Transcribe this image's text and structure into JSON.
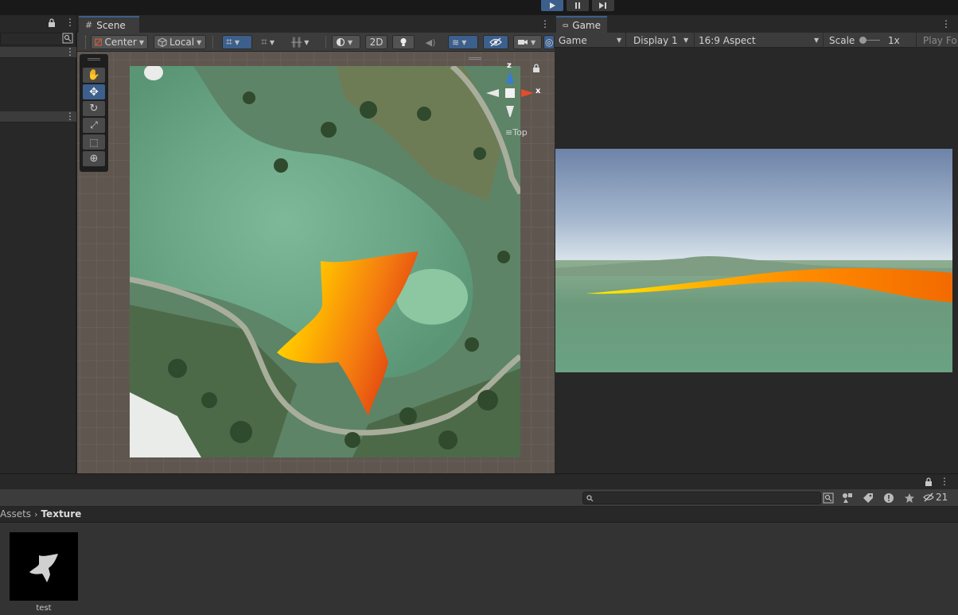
{
  "playbar": {
    "buttons": [
      {
        "name": "play",
        "icon": "play-icon",
        "active": true
      },
      {
        "name": "pause",
        "icon": "pause-icon",
        "active": false
      },
      {
        "name": "step",
        "icon": "step-icon",
        "active": false
      }
    ]
  },
  "scene": {
    "tab_label": "Scene",
    "toolbar": {
      "pivot_label": "Center",
      "space_label": "Local",
      "mode_2d_label": "2D"
    },
    "gizmo": {
      "axis_y": "z",
      "axis_x": "x",
      "view_label": "Top"
    }
  },
  "game": {
    "tab_label": "Game",
    "view_select": "Game",
    "display_select": "Display 1",
    "aspect_select": "16:9 Aspect",
    "scale_label": "Scale",
    "scale_value": "1x",
    "play_focus_label": "Play Fo"
  },
  "project": {
    "breadcrumb": [
      "Assets",
      "Texture"
    ],
    "hidden_count": "21",
    "assets": [
      {
        "name": "test"
      }
    ]
  },
  "colors": {
    "accent": "#3c5f8c",
    "panel": "#3c3c3c",
    "background": "#282828"
  }
}
